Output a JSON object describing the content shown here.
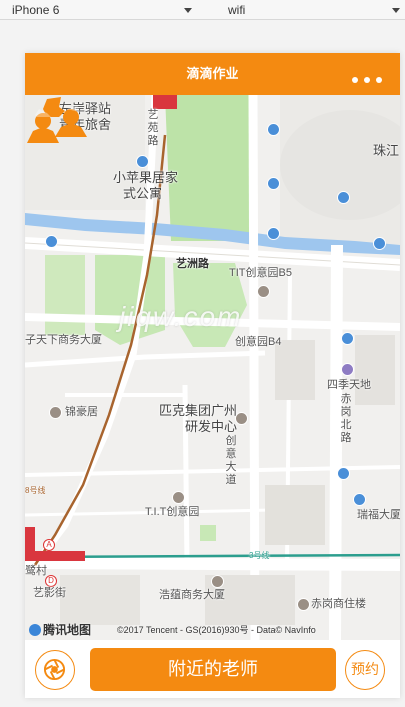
{
  "toolbar": {
    "device": "iPhone 6",
    "network": "wifi"
  },
  "navbar": {
    "title": "滴滴作业",
    "menu_icon": "more-dots-icon"
  },
  "map": {
    "labels": {
      "zuoan_station": "左岸驿站",
      "youth_hostel": "青年旅舍",
      "yiyuan_road": "艺苑路",
      "xiaopingguo": "小苹果居家",
      "apartment": "式公寓",
      "zhujiang": "珠江",
      "yizhou_road": "艺洲路",
      "tit_b5": "TIT创意园B5",
      "tianxia_building": "子天下商务大厦",
      "tit_b4": "创意园B4",
      "sijitiandi": "四季天地",
      "jinhaoju": "锦豪居",
      "chigang_north": "赤岗北路",
      "pike_group": "匹克集团广州",
      "rd_center": "研发中心",
      "chuangyi_avenue": "创意大道",
      "tit_park": "T.I.T创意园",
      "ruifu_building": "瑞福大厦",
      "yiyingjie": "艺影街",
      "haoyun_building": "浩蕴商务大厦",
      "chigang_commerce": "赤岗商住楼",
      "line8": "8号线",
      "line3": "3号线",
      "station": "鹭村"
    },
    "watermark": "jiqw.com",
    "logo": "腾讯地图",
    "copyright": "©2017 Tencent - GS(2016)930号 - Data© NavInfo",
    "accent_color": "#f48a11"
  },
  "bottom": {
    "locate_icon": "locate-aperture-icon",
    "nearby_teacher": "附近的老师",
    "reserve": "预约"
  }
}
